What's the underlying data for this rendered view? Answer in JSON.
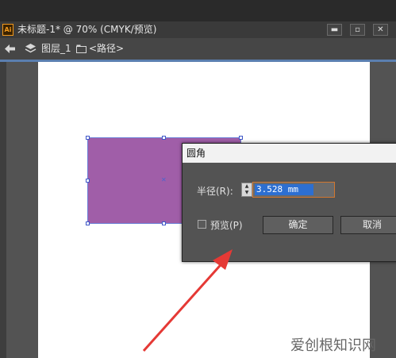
{
  "app": {
    "icon_text": "Ai",
    "document_title": "未标题-1* @ 70% (CMYK/预览)"
  },
  "window_controls": {
    "minimize": "▬",
    "restore": "▫",
    "close": "✕"
  },
  "breadcrumb": {
    "layer_label": "图层_1",
    "path_label": "<路径>"
  },
  "colors": {
    "shape_fill": "#a05ea8",
    "selection": "#3f57c8",
    "field_focus": "#d2772f",
    "arrow": "#e53935"
  },
  "dialog": {
    "title": "圆角",
    "radius_label": "半径(R):",
    "radius_value": "3.528 mm",
    "preview_label": "预览(P)",
    "ok_label": "确定",
    "cancel_label": "取消"
  },
  "watermark": "爱创根知识网"
}
